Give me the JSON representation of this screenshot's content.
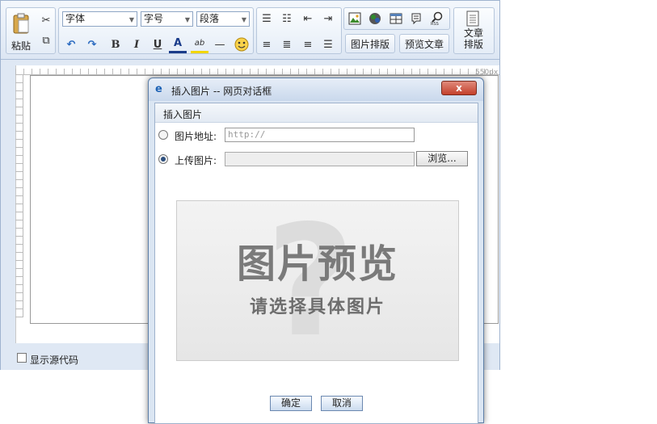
{
  "toolbar": {
    "paste_label": "粘贴",
    "font_select": "字体",
    "size_select": "字号",
    "paragraph_select": "段落",
    "bold_label": "B",
    "italic_label": "I",
    "underline_label": "U",
    "font_color_label": "A",
    "highlight_label": "ab",
    "hr_label": "—",
    "image_layout_label": "图片排版",
    "preview_label": "预览文章",
    "article_layout_label": "文章排版"
  },
  "editor": {
    "width_label": "550px",
    "show_source_label": "显示源代码"
  },
  "dialog": {
    "title": "插入图片 -- 网页对话框",
    "close_label": "x",
    "section_title": "插入图片",
    "url_label": "图片地址:",
    "url_placeholder": "http://",
    "upload_label": "上传图片:",
    "browse_label": "浏览...",
    "preview_title": "图片预览",
    "preview_subtitle": "请选择具体图片",
    "preview_mark": "?",
    "ok_label": "确定",
    "cancel_label": "取消"
  },
  "icons": [
    "paste-icon",
    "cut-icon",
    "copy-icon",
    "undo-icon",
    "redo-icon",
    "ordered-list-icon",
    "unordered-list-icon",
    "outdent-icon",
    "indent-icon",
    "image-icon",
    "flash-icon",
    "table-icon",
    "special-char-icon",
    "search-icon",
    "emoji-icon",
    "align-left-icon",
    "align-center-icon",
    "align-right-icon",
    "justify-icon",
    "document-icon"
  ],
  "colors": {
    "toolbar_bg": "#dce6f3",
    "accent": "#1e63b5",
    "close_red": "#c4402b"
  }
}
